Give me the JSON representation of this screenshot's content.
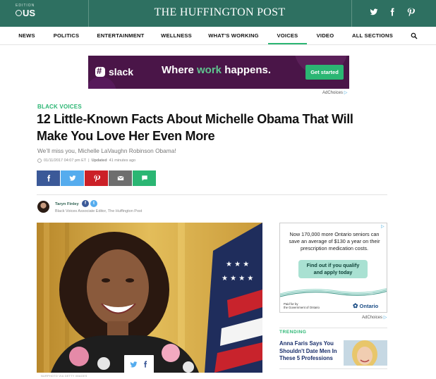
{
  "header": {
    "edition_label": "EDITION",
    "edition_value": "US",
    "brand": "THE HUFFINGTON POST",
    "social_icons": [
      "twitter-icon",
      "facebook-icon",
      "pinterest-icon"
    ]
  },
  "nav": {
    "items": [
      "NEWS",
      "POLITICS",
      "ENTERTAINMENT",
      "WELLNESS",
      "WHAT'S WORKING",
      "VOICES",
      "VIDEO",
      "ALL SECTIONS"
    ],
    "active": "VOICES"
  },
  "banner_ad": {
    "brand": "slack",
    "tagline_pre": "Where ",
    "tagline_highlight": "work",
    "tagline_post": " happens.",
    "cta": "Get started",
    "adchoices": "AdChoices"
  },
  "article": {
    "section": "BLACK VOICES",
    "headline": "12 Little-Known Facts About Michelle Obama That Will Make You Love Her Even More",
    "subhead": "We’ll miss you, Michelle LaVaughn Robinson Obama!",
    "timestamp": "01/11/2017 04:07 pm ET",
    "updated_label": "Updated",
    "updated_value": "41 minutes ago",
    "share_buttons": [
      {
        "name": "facebook",
        "color": "#3b5998"
      },
      {
        "name": "twitter",
        "color": "#55acee"
      },
      {
        "name": "pinterest",
        "color": "#cb2027"
      },
      {
        "name": "email",
        "color": "#6e6e6e"
      },
      {
        "name": "comment",
        "color": "#2bb673"
      }
    ],
    "author_name": "Taryn Finley",
    "author_title": "Black Voices Associate Editor, The Huffington Post",
    "photo_credit": "NURPHOTO VIA GETTY IMAGES"
  },
  "side_ad": {
    "text": "Now 170,000 more Ontario seniors can save an average of $130 a year on their prescription medication costs.",
    "cta_line1": "Find out if you qualify",
    "cta_line2": "and apply today",
    "paid_line1": "Paid for by",
    "paid_line2": "the Government of Ontario",
    "logo": "Ontario",
    "adchoices": "AdChoices"
  },
  "trending": {
    "label": "TRENDING",
    "title": "Anna Faris Says You Shouldn't Date Men In These 5 Professions"
  },
  "colors": {
    "header_bg": "#2e7061",
    "accent_green": "#2bb673",
    "slack_purple": "#4a1548"
  }
}
